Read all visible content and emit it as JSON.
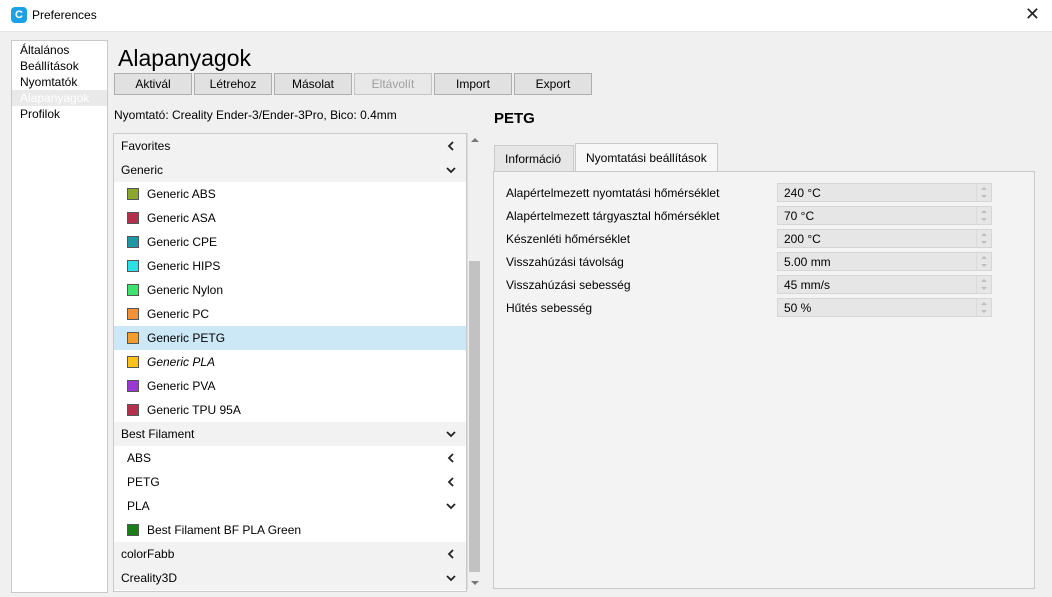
{
  "window": {
    "title": "Preferences",
    "app_icon_glyph": "C"
  },
  "nav": [
    {
      "label": "Általános",
      "active": false
    },
    {
      "label": "Beállítások",
      "active": false
    },
    {
      "label": "Nyomtatók",
      "active": false
    },
    {
      "label": "Alapanyagok",
      "active": true
    },
    {
      "label": "Profilok",
      "active": false
    }
  ],
  "page": {
    "title": "Alapanyagok",
    "printer_line": "Nyomtató: Creality Ender-3/Ender-3Pro, Bico: 0.4mm"
  },
  "toolbar": {
    "activate": "Aktivál",
    "create": "Létrehoz",
    "duplicate": "Másolat",
    "remove": "Eltávolít",
    "import": "Import",
    "export": "Export"
  },
  "materials": [
    {
      "kind": "header",
      "label": "Favorites",
      "chevron": "left"
    },
    {
      "kind": "header",
      "label": "Generic",
      "chevron": "down"
    },
    {
      "kind": "item",
      "label": "Generic ABS",
      "color": "#8ca62d"
    },
    {
      "kind": "item",
      "label": "Generic ASA",
      "color": "#b3304e"
    },
    {
      "kind": "item",
      "label": "Generic CPE",
      "color": "#1f98a3"
    },
    {
      "kind": "item",
      "label": "Generic HIPS",
      "color": "#2de0e6"
    },
    {
      "kind": "item",
      "label": "Generic Nylon",
      "color": "#3de36e"
    },
    {
      "kind": "item",
      "label": "Generic PC",
      "color": "#f2913a"
    },
    {
      "kind": "item",
      "label": "Generic PETG",
      "color": "#f29e2e",
      "selected": true
    },
    {
      "kind": "item",
      "label": "Generic PLA",
      "color": "#fcc21b",
      "italic": true
    },
    {
      "kind": "item",
      "label": "Generic PVA",
      "color": "#9b38d1"
    },
    {
      "kind": "item",
      "label": "Generic TPU 95A",
      "color": "#b3304e"
    },
    {
      "kind": "header",
      "label": "Best Filament",
      "chevron": "down"
    },
    {
      "kind": "sub",
      "label": "ABS",
      "chevron": "left"
    },
    {
      "kind": "sub",
      "label": "PETG",
      "chevron": "left"
    },
    {
      "kind": "sub",
      "label": "PLA",
      "chevron": "down"
    },
    {
      "kind": "item",
      "label": "Best Filament BF PLA Green",
      "color": "#1a7d1a"
    },
    {
      "kind": "header",
      "label": "colorFabb",
      "chevron": "left"
    },
    {
      "kind": "header",
      "label": "Creality3D",
      "chevron": "down"
    }
  ],
  "detail": {
    "material_name": "PETG",
    "tabs": [
      {
        "label": "Információ",
        "active": false
      },
      {
        "label": "Nyomtatási beállítások",
        "active": true
      }
    ],
    "properties": [
      {
        "label": "Alapértelmezett nyomtatási hőmérséklet",
        "value": "240 °C"
      },
      {
        "label": "Alapértelmezett tárgyasztal hőmérséklet",
        "value": "70 °C"
      },
      {
        "label": "Készenléti hőmérséklet",
        "value": "200 °C"
      },
      {
        "label": "Visszahúzási távolság",
        "value": "5.00 mm"
      },
      {
        "label": "Visszahúzási sebesség",
        "value": "45 mm/s"
      },
      {
        "label": "Hűtés sebesség",
        "value": "50 %"
      }
    ]
  },
  "colors": {
    "selection": "#cce8f7",
    "accent": "#1aa1e6"
  }
}
